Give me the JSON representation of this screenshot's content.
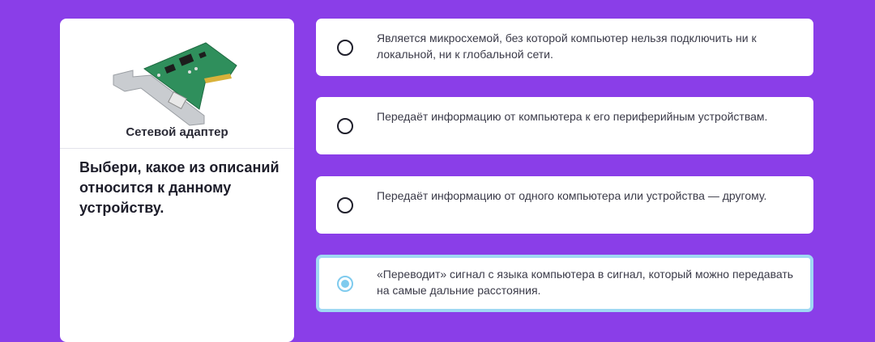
{
  "device": {
    "caption": "Сетевой адаптер",
    "image_icon": "network-card-image"
  },
  "question": {
    "text": "Выбери, какое из описаний относится к данному устройству."
  },
  "options": [
    {
      "text": "Является микросхемой, без которой компьютер нельзя подключить ни к локальной, ни к глобальной сети.",
      "selected": false
    },
    {
      "text": "Передаёт информацию от компьютера к его периферийным устройствам.",
      "selected": false
    },
    {
      "text": "Передаёт информацию от одного компьютера или устройства — другому.",
      "selected": false
    },
    {
      "text": "«Переводит» сигнал с языка компьютера в сигнал, который можно передавать на самые дальние расстояния.",
      "selected": true
    }
  ],
  "colors": {
    "background": "#8a3ee8",
    "card": "#ffffff",
    "selected_accent": "#9fd8f3"
  }
}
